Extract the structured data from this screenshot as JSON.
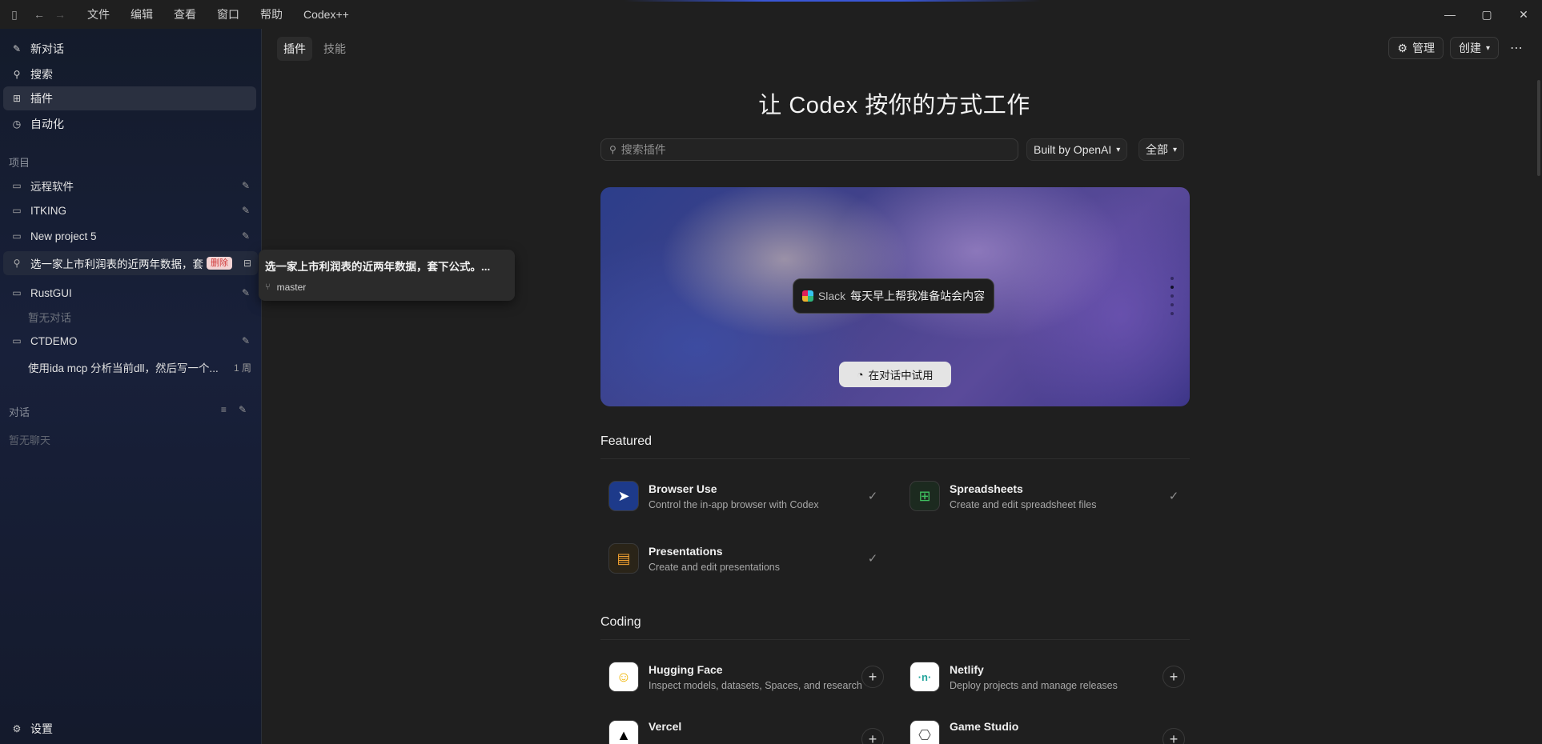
{
  "titlebar": {
    "menu": [
      "文件",
      "编辑",
      "查看",
      "窗口",
      "帮助",
      "Codex++"
    ]
  },
  "sidebar": {
    "nav": [
      {
        "label": "新对话",
        "icon": "edit-icon"
      },
      {
        "label": "搜索",
        "icon": "search-icon"
      },
      {
        "label": "插件",
        "icon": "grid-icon"
      },
      {
        "label": "自动化",
        "icon": "clock-icon"
      }
    ],
    "projects_label": "项目",
    "projects": [
      {
        "label": "远程软件"
      },
      {
        "label": "ITKING"
      },
      {
        "label": "New project 5"
      }
    ],
    "pinned_thread": {
      "label": "选一家上市利润表的近两年数据，套",
      "delete_label": "删除"
    },
    "rustgui": {
      "label": "RustGUI",
      "empty": "暂无对话"
    },
    "ctdemo": {
      "label": "CTDEMO",
      "thread": "使用ida mcp 分析当前dll，然后写一个...",
      "thread_time": "1 周"
    },
    "dialogs_label": "对话",
    "no_chats": "暂无聊天",
    "settings": "设置"
  },
  "tooltip": {
    "title": "选一家上市利润表的近两年数据，套下公式。...",
    "branch": "master"
  },
  "main": {
    "tabs": [
      "插件",
      "技能"
    ],
    "manage": "管理",
    "create": "创建",
    "heading": "让 Codex 按你的方式工作",
    "search_placeholder": "搜索插件",
    "filter_builder": "Built by OpenAI",
    "filter_all": "全部",
    "hero": {
      "app": "Slack",
      "prompt": "每天早上帮我准备站会内容",
      "try_label": "在对话中试用"
    },
    "featured_title": "Featured",
    "featured": [
      {
        "name": "Browser Use",
        "desc": "Control the in-app browser with Codex",
        "icon": "browser-use-icon",
        "installed": true
      },
      {
        "name": "Spreadsheets",
        "desc": "Create and edit spreadsheet files",
        "icon": "spreadsheet-icon",
        "installed": true
      },
      {
        "name": "Presentations",
        "desc": "Create and edit presentations",
        "icon": "presentation-icon",
        "installed": true
      }
    ],
    "coding_title": "Coding",
    "coding": [
      {
        "name": "Hugging Face",
        "desc": "Inspect models, datasets, Spaces, and research",
        "icon": "hugging-face-icon"
      },
      {
        "name": "Netlify",
        "desc": "Deploy projects and manage releases",
        "icon": "netlify-icon"
      },
      {
        "name": "Vercel",
        "desc": "",
        "icon": "vercel-icon"
      },
      {
        "name": "Game Studio",
        "desc": "",
        "icon": "game-controller-icon"
      }
    ]
  },
  "colors": {
    "sidebar_bg": "#18203a",
    "main_bg": "#1f1f1f",
    "delete_badge_bg": "#f3d4d4",
    "delete_badge_text": "#d13b3b"
  }
}
